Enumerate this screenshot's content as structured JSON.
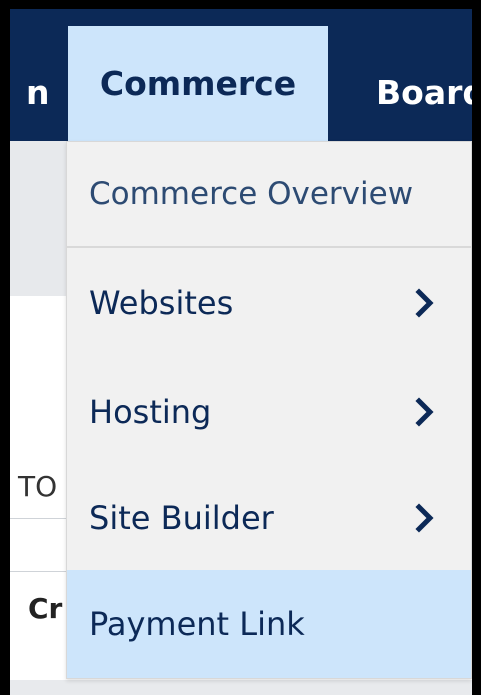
{
  "nav": {
    "prev_label_partial": "n",
    "commerce_label": "Commerce",
    "board_label": "Board"
  },
  "background": {
    "text_to": "TO",
    "text_cr": "Cr"
  },
  "dropdown": {
    "items": [
      {
        "label": "Commerce Overview",
        "has_submenu": false
      },
      {
        "label": "Websites",
        "has_submenu": true
      },
      {
        "label": "Hosting",
        "has_submenu": true
      },
      {
        "label": "Site Builder",
        "has_submenu": true
      },
      {
        "label": "Payment Link",
        "has_submenu": false,
        "highlighted": true
      }
    ]
  },
  "colors": {
    "nav_bg": "#0c2957",
    "active_bg": "#cde5fb",
    "menu_bg": "#f1f1f1",
    "text_navy": "#0c2957"
  },
  "icons": [
    "chevron-right-icon"
  ]
}
